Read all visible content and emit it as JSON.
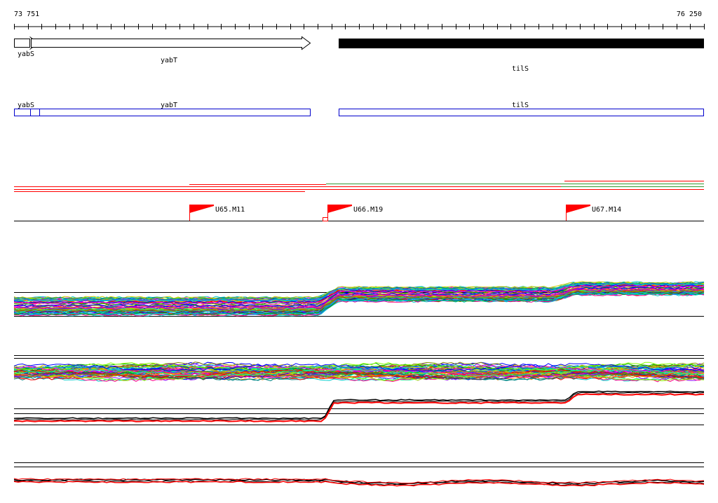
{
  "ruler": {
    "start_label": "73 751",
    "end_label": "76 250",
    "tick_count": 50
  },
  "genes": {
    "yabS": {
      "label": "yabS",
      "strand": "+",
      "style": "outline"
    },
    "yabT": {
      "label": "yabT",
      "strand": "+",
      "style": "outline"
    },
    "tilS": {
      "label": "tilS",
      "strand": "+",
      "style": "filled"
    }
  },
  "cds_track": [
    {
      "label": "yabS"
    },
    {
      "label": "yabT"
    },
    {
      "label": "tilS"
    }
  ],
  "markers": [
    {
      "label": "U65.M11"
    },
    {
      "label": "U66.M19"
    },
    {
      "label": "U67.M14"
    }
  ],
  "colors": {
    "cds_outline": "#0000cc",
    "marker_flag": "#ff0000",
    "segment_red": "#ff0000",
    "segment_green": "#339933",
    "palette": [
      "#ff0000",
      "#00aa00",
      "#0000ff",
      "#ff00ff",
      "#00cccc",
      "#cccc00",
      "#ff8800",
      "#8800ff",
      "#008888",
      "#888800",
      "#ff0088",
      "#0088ff",
      "#88ff00",
      "#444444",
      "#aa5500",
      "#00ff88"
    ]
  }
}
